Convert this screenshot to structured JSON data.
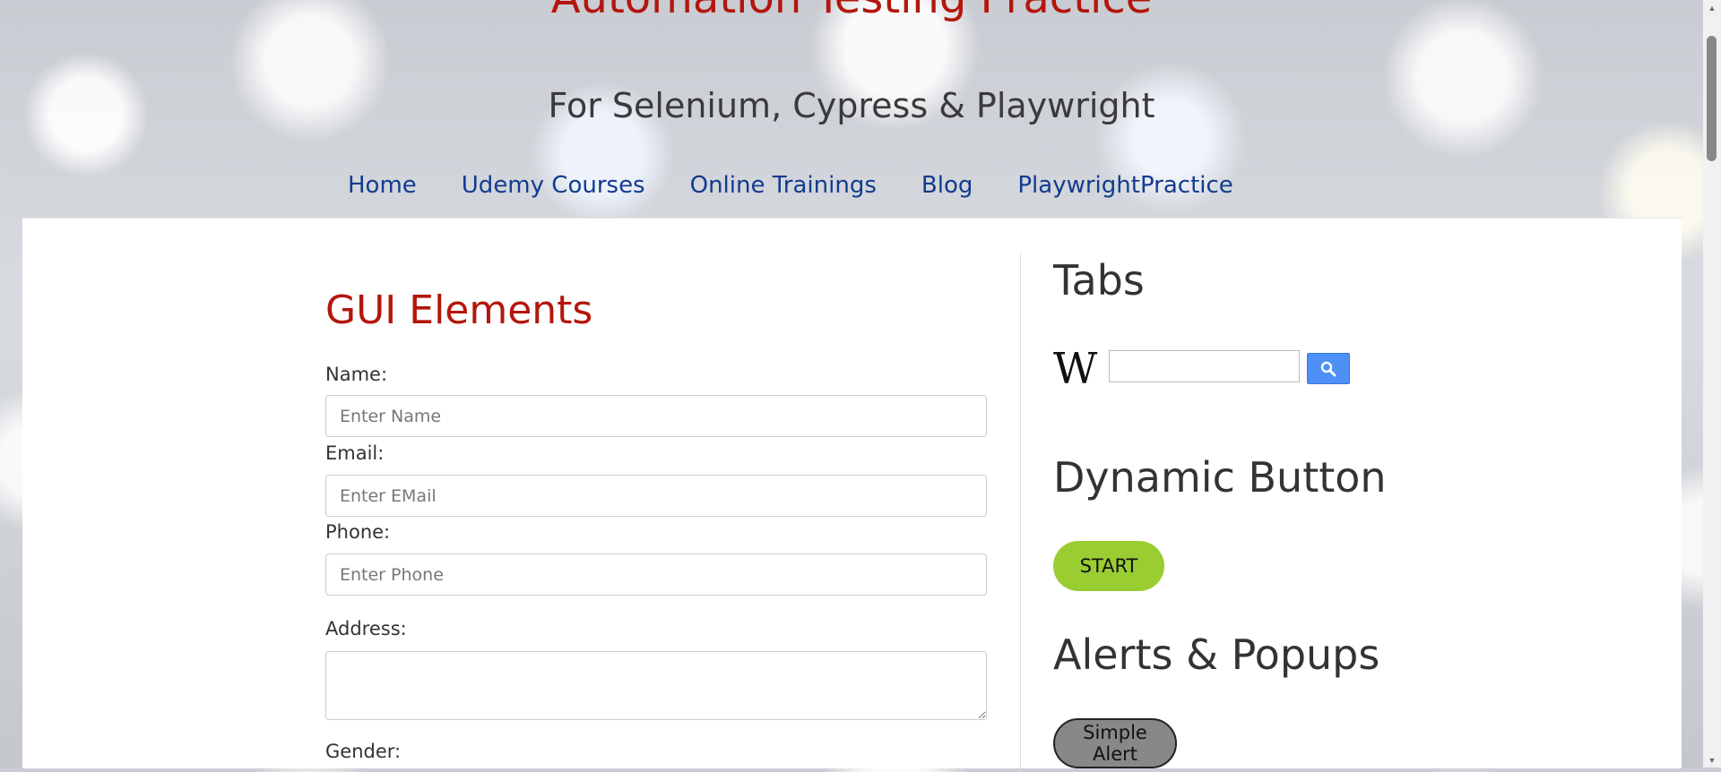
{
  "header": {
    "title": "Automation Testing Practice",
    "subtitle": "For Selenium, Cypress & Playwright"
  },
  "nav": {
    "items": [
      {
        "label": "Home"
      },
      {
        "label": "Udemy Courses"
      },
      {
        "label": "Online Trainings"
      },
      {
        "label": "Blog"
      },
      {
        "label": "PlaywrightPractice"
      }
    ]
  },
  "gui": {
    "title": "GUI Elements",
    "name_label": "Name:",
    "name_placeholder": "Enter Name",
    "email_label": "Email:",
    "email_placeholder": "Enter EMail",
    "phone_label": "Phone:",
    "phone_placeholder": "Enter Phone",
    "address_label": "Address:",
    "gender_label": "Gender:"
  },
  "sidebar": {
    "tabs_title": "Tabs",
    "wiki_logo": "W",
    "dynamic_title": "Dynamic Button",
    "start_label": "START",
    "alerts_title": "Alerts & Popups",
    "simple_alert_label": "Simple Alert"
  },
  "colors": {
    "title_red": "#b3160c",
    "nav_blue": "#123b8f",
    "start_green": "#9acd32",
    "search_blue": "#4e90f5"
  }
}
